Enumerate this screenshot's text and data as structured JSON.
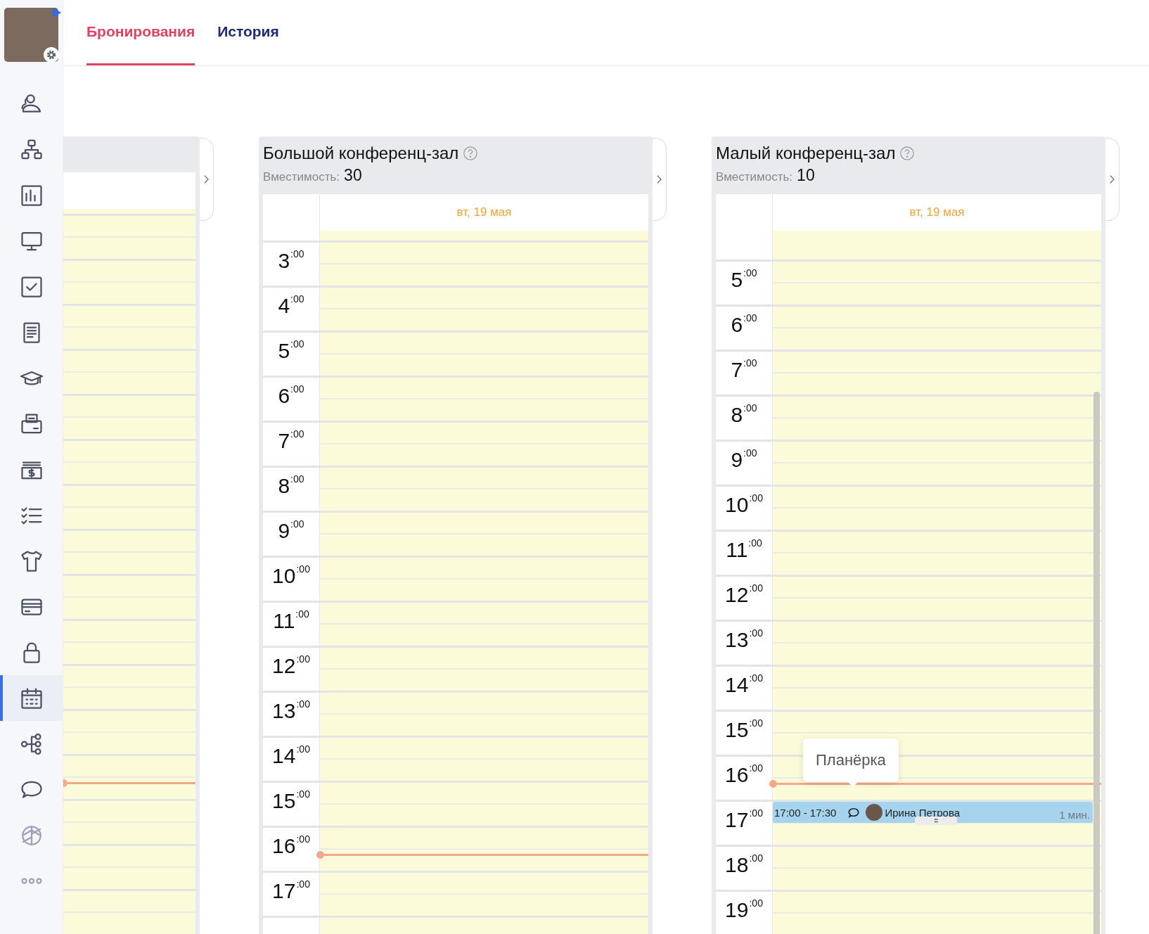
{
  "sidebar": {
    "items": [
      {
        "kind": "users",
        "selected": false
      },
      {
        "kind": "structure",
        "selected": false
      },
      {
        "kind": "chart",
        "selected": false
      },
      {
        "kind": "monitor",
        "selected": false
      },
      {
        "kind": "checkbox",
        "selected": false
      },
      {
        "kind": "document",
        "selected": false
      },
      {
        "kind": "graduation",
        "selected": false
      },
      {
        "kind": "printer",
        "selected": false
      },
      {
        "kind": "cash",
        "selected": false
      },
      {
        "kind": "checklist",
        "selected": false
      },
      {
        "kind": "shirt",
        "selected": false
      },
      {
        "kind": "card",
        "selected": false
      },
      {
        "kind": "lock",
        "selected": false
      },
      {
        "kind": "calendar",
        "selected": true
      },
      {
        "kind": "flow",
        "selected": false
      },
      {
        "kind": "chat",
        "selected": false
      },
      {
        "kind": "knot",
        "selected": false
      },
      {
        "kind": "more",
        "selected": false
      }
    ]
  },
  "tabs": [
    {
      "label": "Бронирования",
      "selected": true
    },
    {
      "label": "История",
      "selected": false
    }
  ],
  "columns": [
    {
      "kind": "partial",
      "rows": [
        {
          "now_line": false
        },
        {
          "now_line": false
        },
        {
          "now_line": false
        },
        {
          "now_line": false
        },
        {
          "now_line": false
        },
        {
          "now_line": false
        },
        {
          "now_line": false
        },
        {
          "now_line": false
        },
        {
          "now_line": false
        },
        {
          "now_line": false
        },
        {
          "now_line": false
        },
        {
          "now_line": false
        },
        {
          "now_line": true
        },
        {
          "now_line": false
        },
        {
          "now_line": false
        },
        {
          "now_line": false
        }
      ]
    },
    {
      "kind": "room",
      "title": "Большой конференц-зал",
      "capacity_label": "Вместимость:",
      "capacity": "30",
      "date": "вт, 19 мая",
      "rows": [
        {
          "label": "3$^{:00}$",
          "now_line": false
        },
        {
          "label": "4$^{:00}$",
          "now_line": false
        },
        {
          "label": "5$^{:00}$",
          "now_line": false
        },
        {
          "label": "6$^{:00}$",
          "now_line": false
        },
        {
          "label": "7$^{:00}$",
          "now_line": false
        },
        {
          "label": "8$^{:00}$",
          "now_line": false
        },
        {
          "label": "9$^{:00}$",
          "now_line": false
        },
        {
          "label": "10$^{:00}$",
          "now_line": false
        },
        {
          "label": "11$^{:00}$",
          "now_line": false
        },
        {
          "label": "12$^{:00}$",
          "now_line": false
        },
        {
          "label": "13$^{:00}$",
          "now_line": false
        },
        {
          "label": "14$^{:00}$",
          "now_line": false
        },
        {
          "label": "15$^{:00}$",
          "now_line": false
        },
        {
          "label": "16$^{:00}$",
          "now_line": true
        },
        {
          "label": "17$^{:00}$",
          "now_line": false
        },
        {
          "now_line": false
        }
      ]
    },
    {
      "kind": "room",
      "title": "Малый конференц-зал",
      "capacity_label": "Вместимость:",
      "capacity": "10",
      "date": "вт, 19 мая",
      "scrollbar": true,
      "rows": [
        {
          "label": "5$^{:00}$",
          "now_line": false
        },
        {
          "label": "6$^{:00}$",
          "now_line": false
        },
        {
          "label": "7$^{:00}$",
          "now_line": false
        },
        {
          "label": "8$^{:00}$",
          "now_line": false
        },
        {
          "label": "9$^{:00}$",
          "now_line": false
        },
        {
          "label": "10$^{:00}$",
          "now_line": false
        },
        {
          "label": "11$^{:00}$",
          "now_line": false
        },
        {
          "label": "12$^{:00}$",
          "now_line": false
        },
        {
          "label": "13$^{:00}$",
          "now_line": false
        },
        {
          "label": "14$^{:00}$",
          "now_line": false
        },
        {
          "label": "15$^{:00}$",
          "now_line": false
        },
        {
          "label": "16$^{:00}$",
          "now_line": true
        },
        {
          "label": "17$^{:00}$",
          "now_line": false,
          "events": [
            {
              "time": "17:00 - 17:30",
              "has_comment": true,
              "person": "Ирина Петрова",
              "duration": "1 мин.",
              "tooltip": "Планёрка"
            }
          ]
        },
        {
          "label": "18$^{:00}$",
          "now_line": false
        },
        {
          "label": "19$^{:00}$",
          "now_line": false
        }
      ]
    }
  ]
}
